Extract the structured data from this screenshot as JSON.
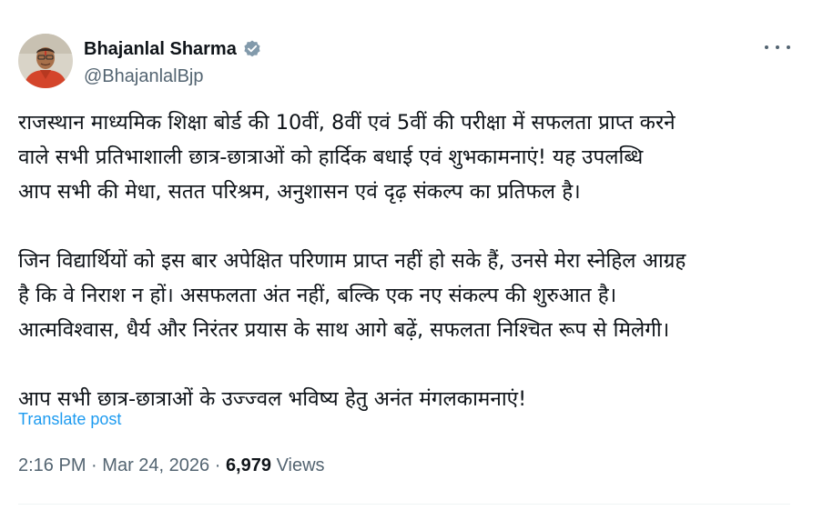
{
  "author": {
    "display_name": "Bhajanlal Sharma",
    "handle": "@BhajanlalBjp",
    "verified_icon": "verified-badge-icon",
    "verified_color": "#829aab",
    "avatar_icon": "profile-avatar"
  },
  "menu": {
    "icon": "more-options-icon"
  },
  "post": {
    "paragraph1": [
      "राजस्थान माध्यमिक शिक्षा बोर्ड की 10वीं, 8वीं एवं 5वीं की परीक्षा में सफलता प्राप्त करने",
      "वाले सभी प्रतिभाशाली छात्र-छात्राओं को हार्दिक बधाई एवं शुभकामनाएं! यह उपलब्धि",
      "आप सभी की मेधा, सतत परिश्रम, अनुशासन एवं दृढ़ संकल्प का प्रतिफल है।"
    ],
    "paragraph2": [
      "जिन विद्यार्थियों को इस बार अपेक्षित परिणाम प्राप्त नहीं हो सके हैं, उनसे मेरा स्नेहिल आग्रह",
      "है कि वे निराश न हों। असफलता अंत नहीं, बल्कि एक नए संकल्प की शुरुआत है।",
      "आत्मविश्वास, धैर्य और निरंतर प्रयास के साथ आगे बढ़ें, सफलता निश्चित रूप से मिलेगी।"
    ],
    "paragraph3": [
      "आप सभी छात्र-छात्राओं के उज्ज्वल भविष्य हेतु अनंत मंगलकामनाएं!"
    ]
  },
  "translate_label": "Translate post",
  "meta": {
    "time": "2:16 PM",
    "separator": "·",
    "date": "Mar 24, 2026",
    "views_count": "6,979",
    "views_label": "Views"
  },
  "colors": {
    "link": "#1d9bf0",
    "secondary_text": "#536471",
    "primary_text": "#0f1419"
  }
}
